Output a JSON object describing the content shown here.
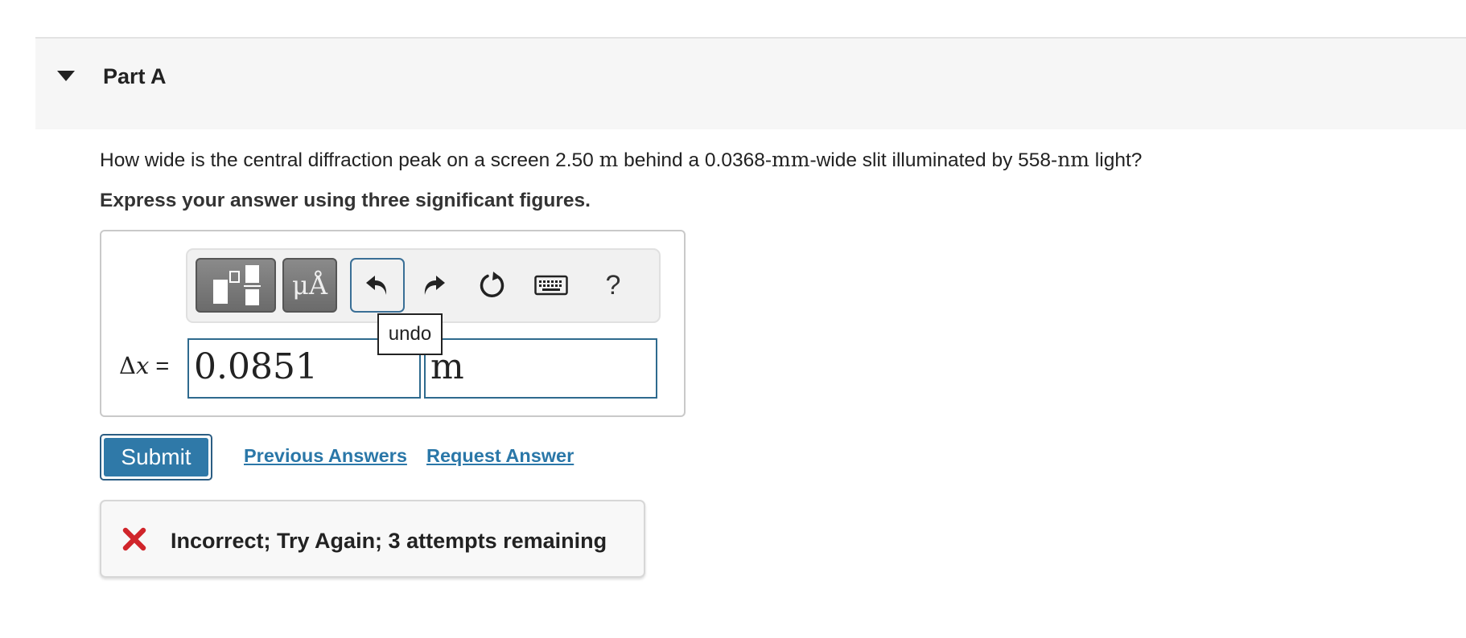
{
  "part": {
    "title": "Part A"
  },
  "question": {
    "text_1": "How wide is the central diffraction peak on a screen 2.50 ",
    "unit_m": "m",
    "text_2": " behind a 0.0368-",
    "unit_mm": "mm",
    "text_3": "-wide slit illuminated by 558-",
    "unit_nm": "nm",
    "text_4": " light?",
    "instruction": "Express your answer using three significant figures."
  },
  "toolbar": {
    "templates_icon": "fraction-templates-icon",
    "units_label": "μÅ",
    "undo_icon": "undo-icon",
    "redo_icon": "redo-icon",
    "reset_icon": "reset-icon",
    "keyboard_icon": "keyboard-icon",
    "help_label": "?",
    "tooltip": "undo"
  },
  "answer": {
    "delta": "Δ",
    "variable": "x",
    "equals": " =",
    "value": "0.0851",
    "unit": "m"
  },
  "actions": {
    "submit": "Submit",
    "previous_answers": "Previous Answers",
    "request_answer": "Request Answer"
  },
  "feedback": {
    "icon": "x-mark-icon",
    "message": "Incorrect; Try Again; 3 attempts remaining",
    "color": "#d0252b"
  },
  "colors": {
    "accent": "#2f79a8",
    "input_border": "#2e6a8e"
  }
}
